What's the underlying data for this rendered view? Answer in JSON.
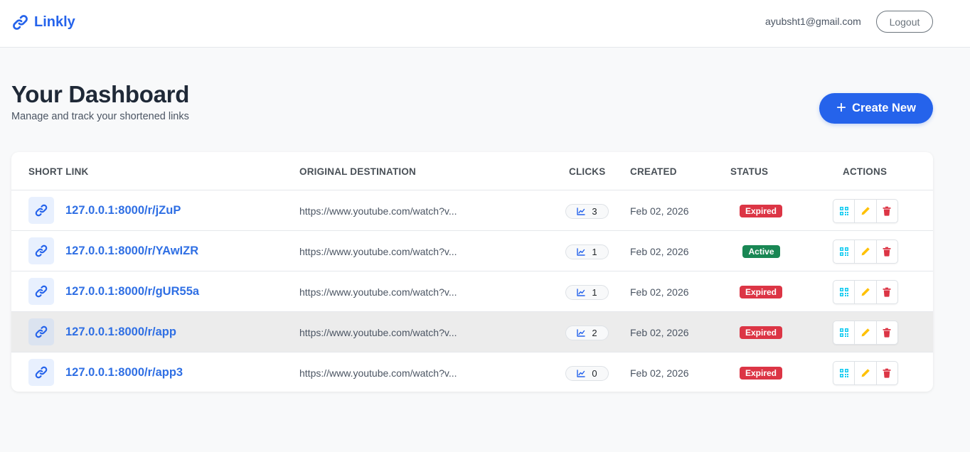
{
  "nav": {
    "brand": "Linkly",
    "user_email": "ayubsht1@gmail.com",
    "logout_label": "Logout"
  },
  "header": {
    "title": "Your Dashboard",
    "subtitle": "Manage and track your shortened links",
    "create_label": "Create New"
  },
  "table": {
    "columns": {
      "short_link": "SHORT LINK",
      "destination": "ORIGINAL DESTINATION",
      "clicks": "CLICKS",
      "created": "CREATED",
      "status": "STATUS",
      "actions": "ACTIONS"
    },
    "rows": [
      {
        "short_link": "127.0.0.1:8000/r/jZuP",
        "destination": "https://www.youtube.com/watch?v...",
        "clicks": "3",
        "created": "Feb 02, 2026",
        "status": "Expired"
      },
      {
        "short_link": "127.0.0.1:8000/r/YAwIZR",
        "destination": "https://www.youtube.com/watch?v...",
        "clicks": "1",
        "created": "Feb 02, 2026",
        "status": "Active"
      },
      {
        "short_link": "127.0.0.1:8000/r/gUR55a",
        "destination": "https://www.youtube.com/watch?v...",
        "clicks": "1",
        "created": "Feb 02, 2026",
        "status": "Expired"
      },
      {
        "short_link": "127.0.0.1:8000/r/app",
        "destination": "https://www.youtube.com/watch?v...",
        "clicks": "2",
        "created": "Feb 02, 2026",
        "status": "Expired"
      },
      {
        "short_link": "127.0.0.1:8000/r/app3",
        "destination": "https://www.youtube.com/watch?v...",
        "clicks": "0",
        "created": "Feb 02, 2026",
        "status": "Expired"
      }
    ]
  },
  "colors": {
    "primary": "#2563eb",
    "expired": "#dc3545",
    "active": "#198754",
    "qr_icon": "#0dcaf0",
    "edit_icon": "#ffc107",
    "delete_icon": "#dc3545"
  },
  "icons": {
    "brand": "link-icon",
    "row": "link-icon",
    "clicks": "chart-line-icon",
    "qr": "qr-code-icon",
    "edit": "pencil-icon",
    "delete": "trash-icon",
    "create": "plus-icon"
  }
}
